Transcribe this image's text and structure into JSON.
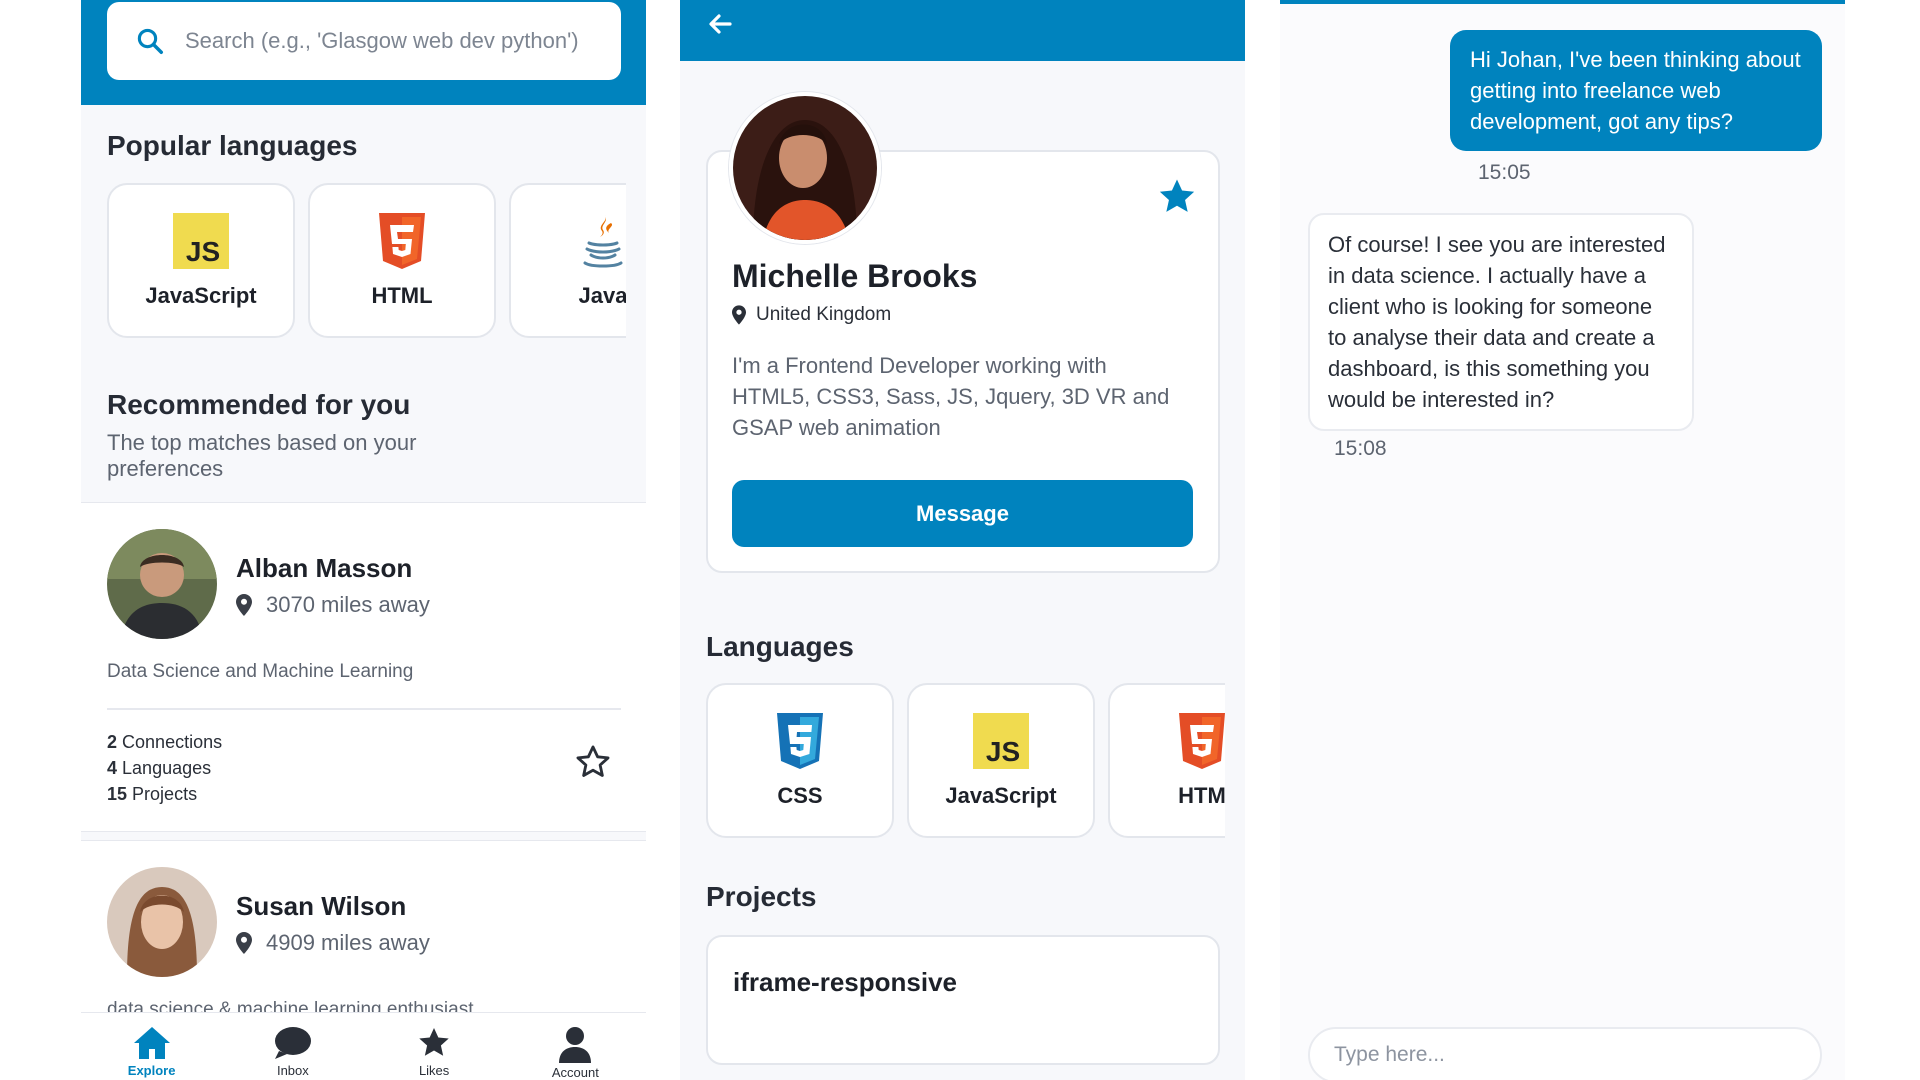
{
  "explore": {
    "search_placeholder": "Search (e.g., 'Glasgow web dev python')",
    "popular_title": "Popular languages",
    "popular_languages": [
      {
        "label": "JavaScript",
        "icon": "javascript-icon"
      },
      {
        "label": "HTML",
        "icon": "html5-icon"
      },
      {
        "label": "Java",
        "icon": "java-icon"
      }
    ],
    "recommended_title": "Recommended for you",
    "recommended_subtitle": "The top matches based on your preferences",
    "people": [
      {
        "name": "Alban Masson",
        "distance": "3070 miles away",
        "bio": "Data Science and Machine Learning",
        "connections_count": "2",
        "connections_label": "Connections",
        "languages_count": "4",
        "languages_label": "Languages",
        "projects_count": "15",
        "projects_label": "Projects"
      },
      {
        "name": "Susan Wilson",
        "distance": "4909 miles away",
        "bio": "data science & machine learning enthusiast"
      }
    ],
    "nav": [
      {
        "label": "Explore",
        "icon": "home-icon",
        "active": true
      },
      {
        "label": "Inbox",
        "icon": "chat-bubble-icon"
      },
      {
        "label": "Likes",
        "icon": "star-icon"
      },
      {
        "label": "Account",
        "icon": "user-icon"
      }
    ]
  },
  "profile": {
    "name": "Michelle Brooks",
    "location": "United Kingdom",
    "bio": "I'm a Frontend Developer working with HTML5, CSS3, Sass, JS, Jquery, 3D VR and GSAP web animation",
    "message_button": "Message",
    "languages_title": "Languages",
    "languages": [
      {
        "label": "CSS",
        "icon": "css3-icon"
      },
      {
        "label": "JavaScript",
        "icon": "javascript-icon"
      },
      {
        "label": "HTM",
        "icon": "html5-icon"
      }
    ],
    "projects_title": "Projects",
    "projects": [
      {
        "name": "iframe-responsive"
      }
    ]
  },
  "chat": {
    "messages": [
      {
        "from": "me",
        "text": "Hi Johan, I've been thinking about getting into freelance web development, got any tips?",
        "time": "15:05"
      },
      {
        "from": "them",
        "text": "Of course! I see you are interested in data science. I actually have a client who is looking for someone to analyse their data and create a dashboard, is this something you would be interested in?",
        "time": "15:08"
      }
    ],
    "input_placeholder": "Type here..."
  },
  "colors": {
    "brand": "#0083be",
    "js_yellow": "#f0db4f",
    "html_orange": "#e44d26",
    "css_blue": "#1572b6"
  }
}
